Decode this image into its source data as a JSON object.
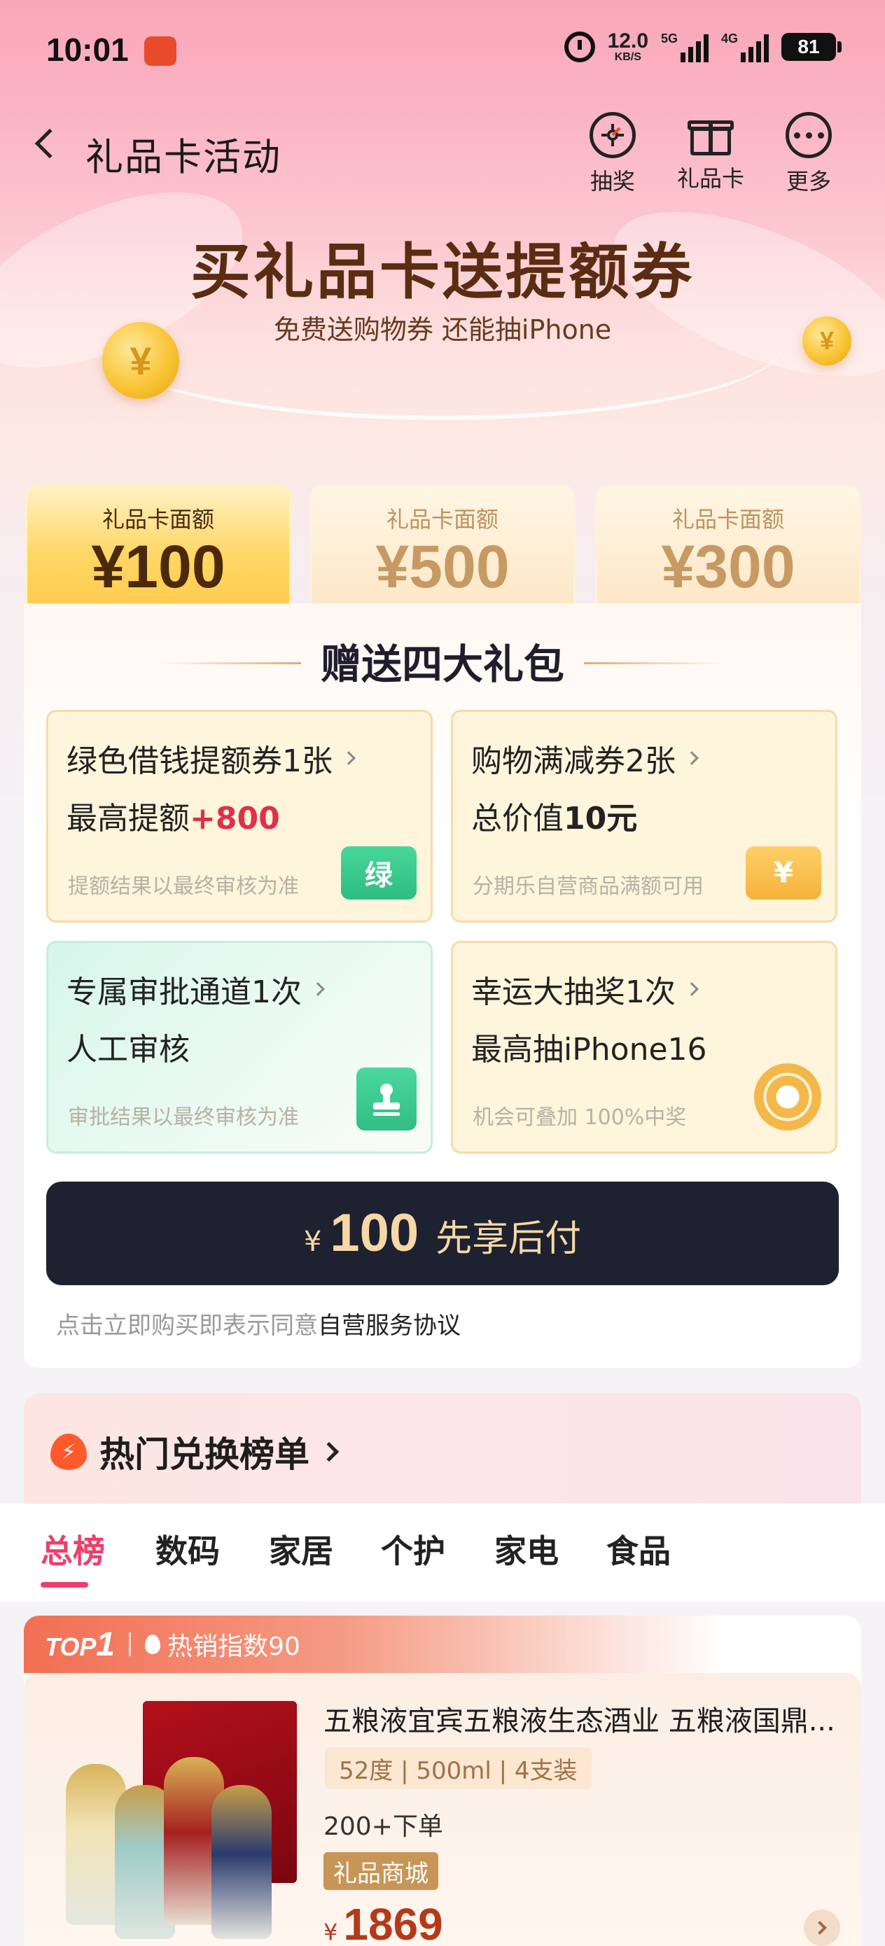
{
  "status_bar": {
    "time": "10:01",
    "net_speed_value": "12.0",
    "net_speed_unit": "KB/S",
    "signal1_label": "5G",
    "signal2_label": "4G",
    "battery": "81"
  },
  "nav": {
    "title": "礼品卡活动",
    "actions": [
      {
        "label": "抽奖",
        "icon": "lottery-icon"
      },
      {
        "label": "礼品卡",
        "icon": "gift-icon"
      },
      {
        "label": "更多",
        "icon": "more-icon"
      }
    ]
  },
  "hero": {
    "title": "买礼品卡送提额券",
    "subtitle": "免费送购物券 还能抽iPhone"
  },
  "denominations": [
    {
      "label": "礼品卡面额",
      "value": "¥100",
      "active": true
    },
    {
      "label": "礼品卡面额",
      "value": "¥500",
      "active": false
    },
    {
      "label": "礼品卡面额",
      "value": "¥300",
      "active": false
    }
  ],
  "gifts": {
    "title": "赠送四大礼包",
    "items": [
      {
        "line1": "绿色借钱提额券1张",
        "line2_prefix": "最高提额",
        "line2_highlight": "+800",
        "note": "提额结果以最终审核为准",
        "badge": "绿",
        "badge_icon": "green-coupon-icon"
      },
      {
        "line1": "购物满减券2张",
        "line2_prefix": "总价值",
        "line2_bold": "10元",
        "note": "分期乐自营商品满额可用",
        "badge": "¥",
        "badge_icon": "yen-coupon-icon"
      },
      {
        "line1": "专属审批通道1次",
        "line2_prefix": "人工审核",
        "note": "审批结果以最终审核为准",
        "badge_icon": "stamp-icon"
      },
      {
        "line1": "幸运大抽奖1次",
        "line2_prefix": "最高抽iPhone16",
        "note": "机会可叠加 100%中奖",
        "badge_icon": "prize-wheel-icon"
      }
    ]
  },
  "pay_button": {
    "currency": "¥",
    "amount": "100",
    "label": "先享后付"
  },
  "agreement": {
    "text": "点击立即购买即表示同意",
    "link": "自营服务协议"
  },
  "hot_list": {
    "title": "热门兑换榜单",
    "tabs": [
      "总榜",
      "数码",
      "家居",
      "个护",
      "家电",
      "食品"
    ],
    "active_tab": 0
  },
  "product": {
    "rank_label": "TOP",
    "rank_num": "1",
    "heat": "热销指数90",
    "name": "五粮液宜宾五粮液生态酒业 五粮液国鼎...",
    "spec": "52度 | 500ml | 4支装",
    "orders": "200+下单",
    "tag": "礼品商城",
    "currency": "¥",
    "price": "1869"
  },
  "colors": {
    "accent_pink": "#ec3f6d",
    "pay_button_bg": "#1d2130",
    "pay_button_text": "#f6d8a7",
    "highlight_red": "#e0304a"
  }
}
